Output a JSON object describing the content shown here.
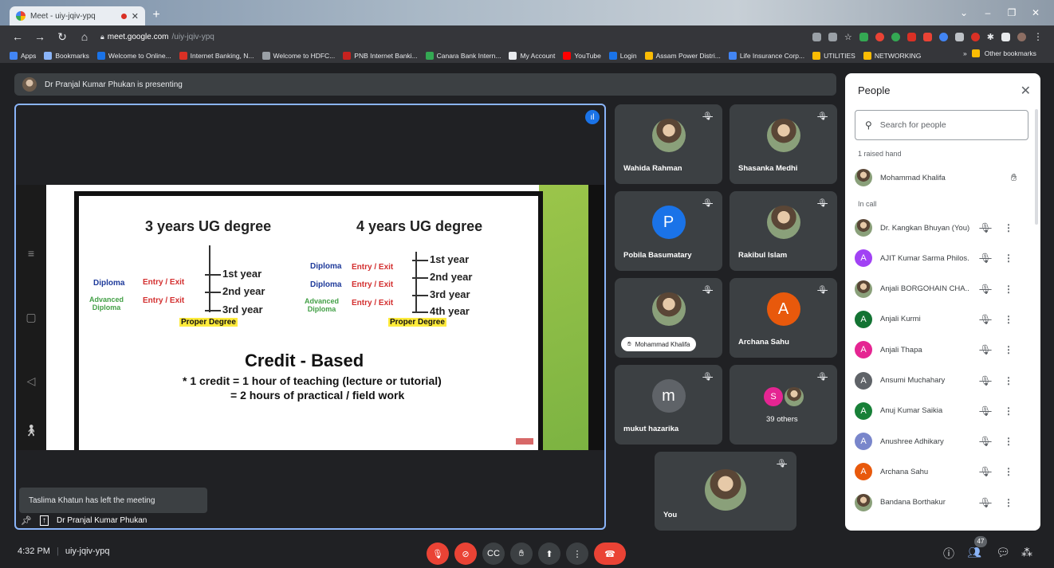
{
  "browser": {
    "tab_title": "Meet - uiy-jqiv-ypq",
    "url_host": "meet.google.com",
    "url_path": "/uiy-jqiv-ypq",
    "bookmarks": [
      {
        "label": "Apps",
        "color": "#4285f4"
      },
      {
        "label": "Bookmarks",
        "color": "#8ab4f8"
      },
      {
        "label": "Welcome to Online...",
        "color": "#1a73e8"
      },
      {
        "label": "Internet Banking, N...",
        "color": "#d93025"
      },
      {
        "label": "Welcome to HDFC...",
        "color": "#9aa0a6"
      },
      {
        "label": "PNB Internet Banki...",
        "color": "#c5221f"
      },
      {
        "label": "Canara Bank Intern...",
        "color": "#34a853"
      },
      {
        "label": "My Account",
        "color": "#e8eaed"
      },
      {
        "label": "YouTube",
        "color": "#ff0000"
      },
      {
        "label": "Login",
        "color": "#1a73e8"
      },
      {
        "label": "Assam Power Distri...",
        "color": "#fbbc04"
      },
      {
        "label": "Life Insurance Corp...",
        "color": "#4285f4"
      },
      {
        "label": "UTILITIES",
        "color": "#fbbc04"
      },
      {
        "label": "NETWORKING",
        "color": "#fbbc04"
      }
    ],
    "more_bookmarks": "»",
    "other_bookmarks": "Other bookmarks"
  },
  "meet": {
    "presenting_banner": "Dr Pranjal Kumar Phukan is presenting",
    "presenter_name": "Dr Pranjal Kumar Phukan",
    "toast": "Taslima Khatun has left the meeting",
    "slide": {
      "left_heading": "3 years UG degree",
      "right_heading": "4 years UG degree",
      "left_years": [
        "1st year",
        "2nd year",
        "3rd year"
      ],
      "right_years": [
        "1st year",
        "2nd year",
        "3rd year",
        "4th year"
      ],
      "diploma": "Diploma",
      "entry_exit": "Entry / Exit",
      "advanced": "Advanced",
      "diploma_word": "Diploma",
      "proper_degree": "Proper Degree",
      "credit_title": "Credit - Based",
      "credit_line1": "* 1 credit = 1 hour of teaching (lecture or tutorial)",
      "credit_line2": "= 2 hours of practical / field work"
    },
    "tiles": [
      {
        "name": "Wahida Rahman",
        "initial": "",
        "color": ""
      },
      {
        "name": "Shasanka Medhi",
        "initial": "",
        "color": ""
      },
      {
        "name": "Pobila Basumatary",
        "initial": "P",
        "color": "#1a73e8"
      },
      {
        "name": "Rakibul Islam",
        "initial": "",
        "color": ""
      },
      {
        "name": "Mohammad Khalifa",
        "initial": "",
        "color": ""
      },
      {
        "name": "Archana Sahu",
        "initial": "A",
        "color": "#e8590c"
      },
      {
        "name": "mukut hazarika",
        "initial": "m",
        "color": "#5f6368"
      },
      {
        "name": "39 others",
        "initial": "S",
        "color": "#e52592"
      },
      {
        "name": "You",
        "initial": "",
        "color": ""
      }
    ],
    "meeting_time": "4:32 PM",
    "meeting_code": "uiy-jqiv-ypq",
    "people_count": "47"
  },
  "people_panel": {
    "title": "People",
    "search_placeholder": "Search for people",
    "raised_hand_label": "1 raised hand",
    "raised": {
      "name": "Mohammad Khalifa"
    },
    "in_call_label": "In call",
    "list": [
      {
        "name": "Dr. Kangkan Bhuyan (You)",
        "initial": "",
        "color": "#8d6e63"
      },
      {
        "name": "AJIT Kumar Sarma Philos...",
        "initial": "A",
        "color": "#a142f4"
      },
      {
        "name": "Anjali BORGOHAIN CHA...",
        "initial": "",
        "color": "#6d4c41"
      },
      {
        "name": "Anjali Kurmi",
        "initial": "A",
        "color": "#137333"
      },
      {
        "name": "Anjali Thapa",
        "initial": "A",
        "color": "#e52592"
      },
      {
        "name": "Ansumi Muchahary",
        "initial": "A",
        "color": "#5f6368"
      },
      {
        "name": "Anuj Kumar Saikia",
        "initial": "A",
        "color": "#188038"
      },
      {
        "name": "Anushree Adhikary",
        "initial": "A",
        "color": "#7986cb"
      },
      {
        "name": "Archana Sahu",
        "initial": "A",
        "color": "#e8590c"
      },
      {
        "name": "Bandana Borthakur",
        "initial": "",
        "color": "#5d4037"
      }
    ]
  }
}
